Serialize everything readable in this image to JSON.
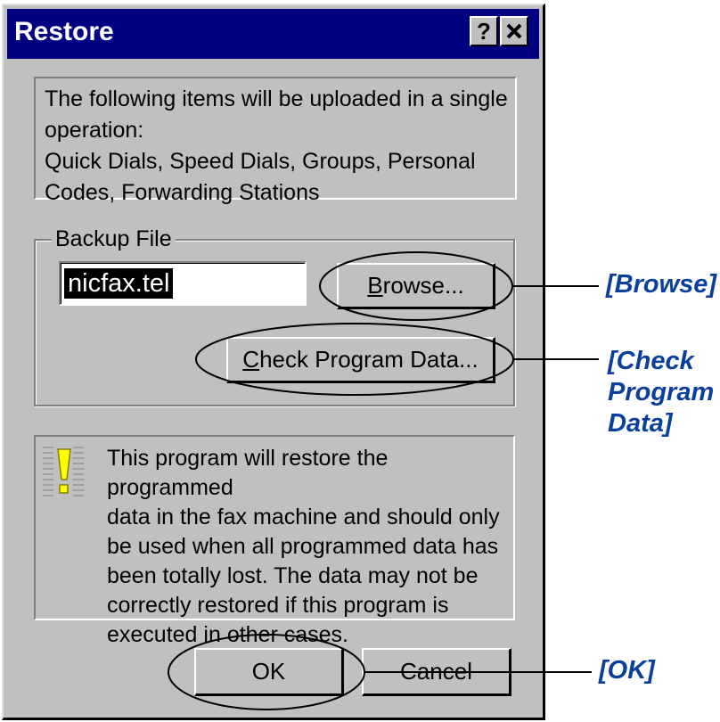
{
  "dialog": {
    "title": "Restore",
    "help_label": "?",
    "close_label": "×"
  },
  "info": {
    "text": "The following items will be uploaded in a single\noperation:\n Quick Dials, Speed Dials, Groups, Personal\nCodes, Forwarding Stations"
  },
  "backup": {
    "group_label": "Backup File",
    "file_value": "nicfax.tel",
    "browse_pre": "",
    "browse_u": "B",
    "browse_post": "rowse...",
    "check_pre": "",
    "check_u": "C",
    "check_post": "heck Program Data..."
  },
  "warning": {
    "icon": "warning-icon",
    "text": "This program will restore the programmed\ndata in the fax machine and should only\nbe used when all programmed data has\nbeen totally lost. The data may not be\ncorrectly restored if this program is\nexecuted in other cases."
  },
  "buttons": {
    "ok_label": "OK",
    "cancel_label": "Cancel"
  },
  "callouts": {
    "browse": "[Browse]",
    "check": "[Check\nProgram\nData]",
    "ok": "[OK]"
  },
  "colors": {
    "callout": "#0b3f9e",
    "titlebar": "#000080",
    "face": "#c0c0c0"
  }
}
